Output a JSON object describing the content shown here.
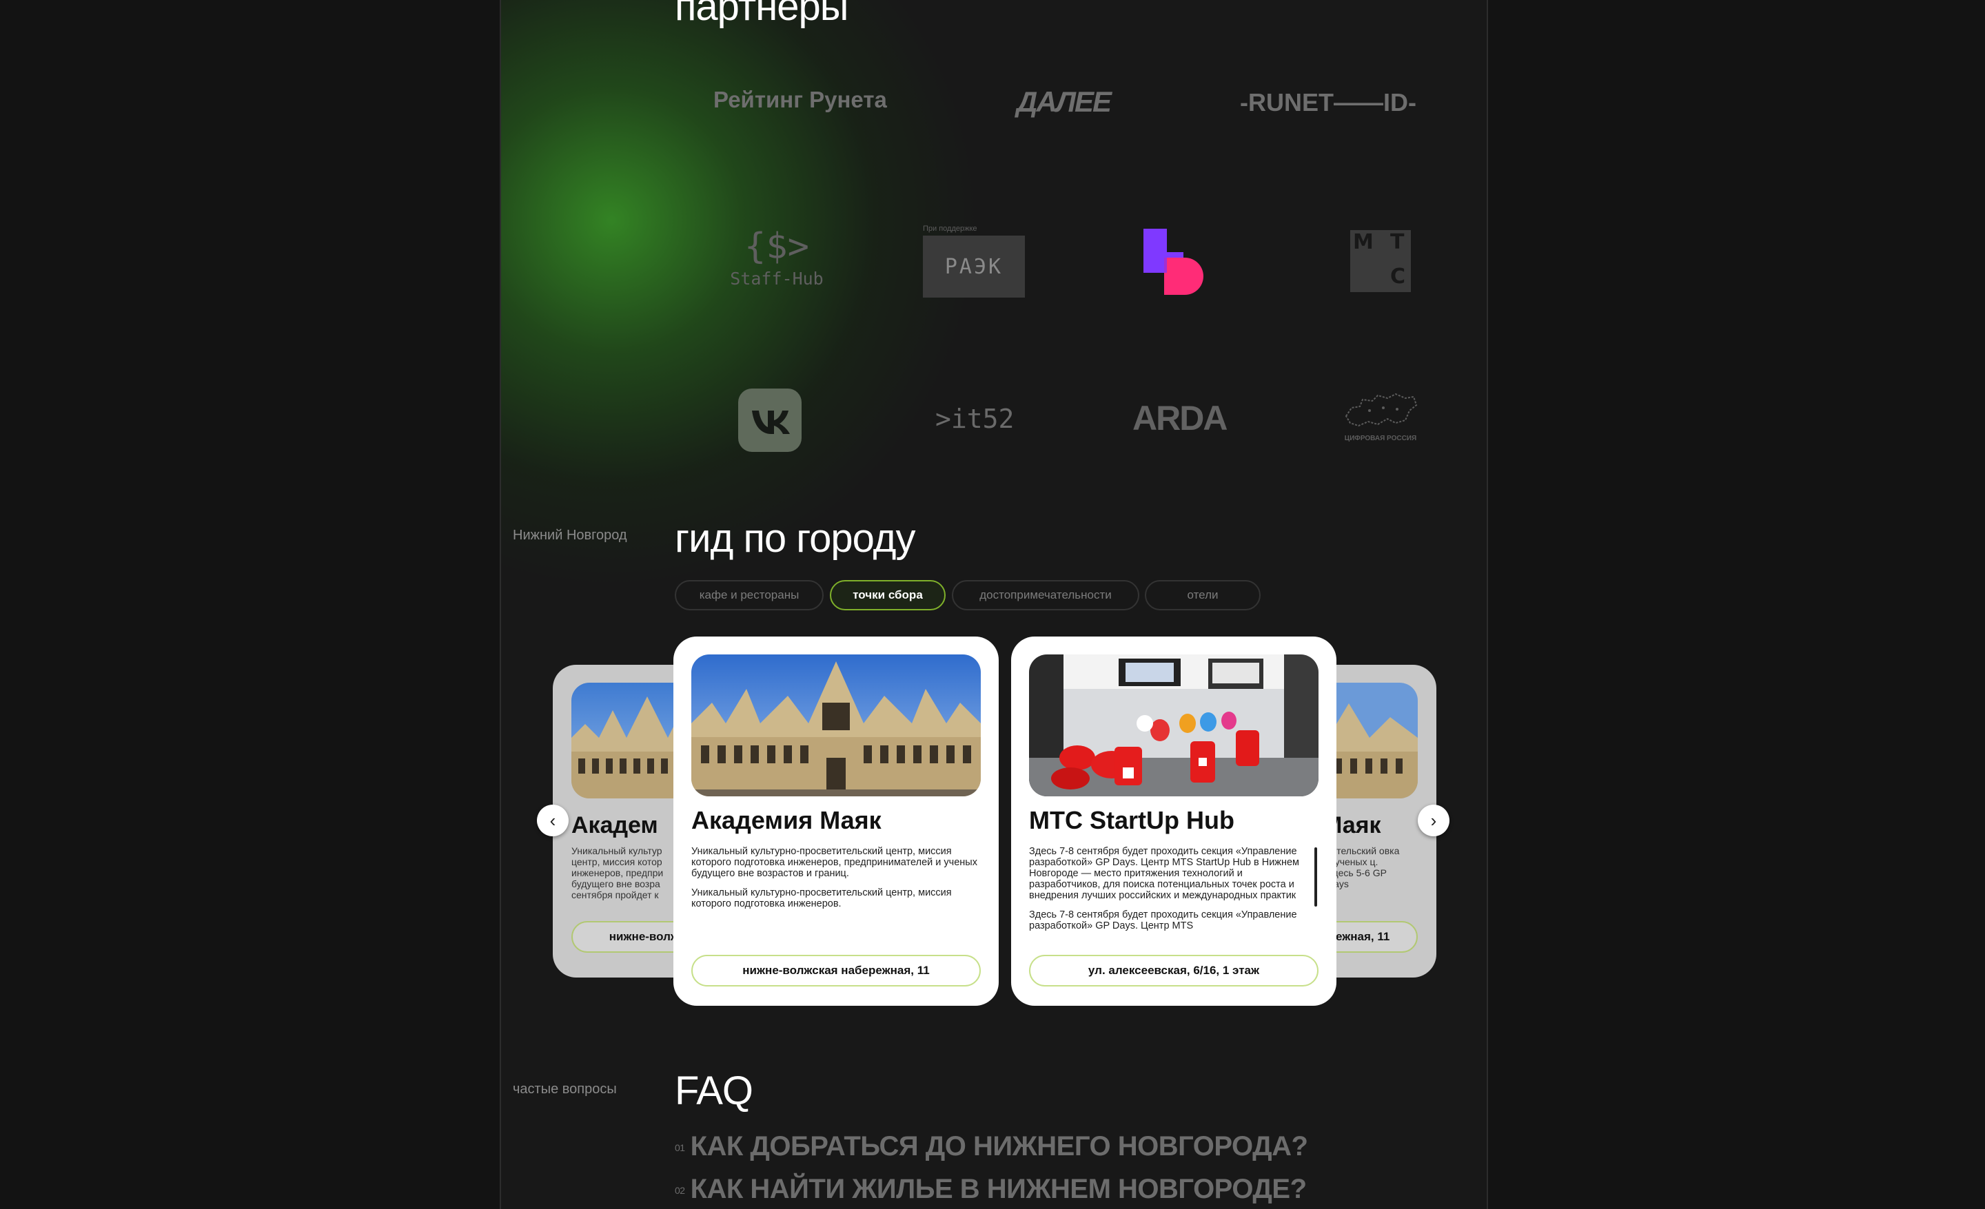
{
  "partners": {
    "title": "партнеры",
    "logos": {
      "runet_rating": "Рейтинг Рунета",
      "aalee": "ДАЛЕЕ",
      "runet_id": "-RUNET——ID-",
      "staffhub_mark": "{$>",
      "staffhub_name": "Staff-Hub",
      "raek_caption": "При поддержке",
      "raek": "РАЭК",
      "vk": "vk-logo",
      "it52": ">it52",
      "arda": "ARDA",
      "mts": [
        "М",
        "Т",
        "С"
      ],
      "digital_russia": "ЦИФРОВАЯ РОССИЯ"
    }
  },
  "guide": {
    "side_label": "Нижний Новгород",
    "title": "гид по городу",
    "tabs": [
      {
        "label": "кафе и рестораны",
        "active": false
      },
      {
        "label": "точки сбора",
        "active": true
      },
      {
        "label": "достопримечательности",
        "active": false
      },
      {
        "label": "отели",
        "active": false
      }
    ],
    "cards": [
      {
        "title": "Академия Маяк",
        "paragraphs": [
          "Уникальный культурно-просветительский центр, миссия которого подготовка инженеров, предпринимателей и ученых будущего вне возрастов и границ.",
          "Уникальный культурно-просветительский центр, миссия которого подготовка инженеров."
        ],
        "address": "нижне-волжская набережная, 11"
      },
      {
        "title": "MTC StartUp Hub",
        "paragraphs": [
          "Здесь 7-8 сентября будет проходить секция «Управление разработкой» GP Days. Центр MTS StartUp Hub в Нижнем Новгороде — место притяжения технологий и разработчиков, для поиска потенциальных точек роста и внедрения лучших российских и международных практик",
          "Здесь 7-8 сентября будет проходить секция «Управление разработкой» GP Days. Центр MTS"
        ],
        "address": "ул. алексеевская, 6/16, 1 этаж"
      }
    ],
    "side_cards": {
      "left": {
        "title": "Академ",
        "text": "Уникальный культур центр, миссия котор инженеров, предпри будущего вне возра сентября пройдет к",
        "address": "нижне-волжс"
      },
      "right": {
        "title": "Маяк",
        "text": "тительский овка и ученых ц. Здесь 5-6 GP Days",
        "address": "бережная, 11"
      }
    },
    "nav": {
      "prev": "‹",
      "next": "›"
    }
  },
  "faq": {
    "side_label": "частые вопросы",
    "title": "FAQ",
    "items": [
      {
        "num": "01",
        "question": "КАК ДОБРАТЬСЯ ДО НИЖНЕГО НОВГОРОДА?"
      },
      {
        "num": "02",
        "question": "КАК НАЙТИ ЖИЛЬЕ В НИЖНЕМ НОВГОРОДЕ?"
      }
    ]
  }
}
